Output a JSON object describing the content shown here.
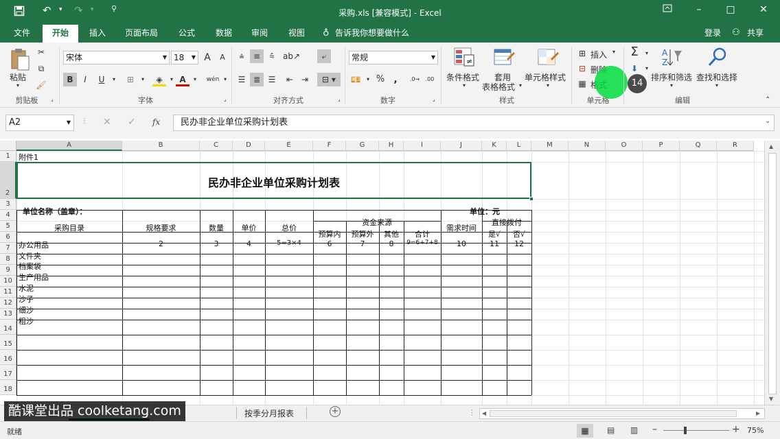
{
  "window": {
    "title": "采购.xls  [兼容模式] - Excel",
    "login": "登录",
    "share": "共享"
  },
  "tabs": [
    {
      "label": "文件"
    },
    {
      "label": "开始"
    },
    {
      "label": "插入"
    },
    {
      "label": "页面布局"
    },
    {
      "label": "公式"
    },
    {
      "label": "数据"
    },
    {
      "label": "审阅"
    },
    {
      "label": "视图"
    },
    {
      "label": "告诉我你想要做什么"
    }
  ],
  "ribbon": {
    "clipboard": {
      "paste": "粘贴",
      "group": "剪贴板"
    },
    "font": {
      "name": "宋体",
      "size": "18",
      "grow": "A",
      "shrink": "A",
      "bold": "B",
      "italic": "I",
      "underline": "U",
      "fontcolor": "A",
      "phonetic": "wén",
      "group": "字体"
    },
    "alignment": {
      "group": "对齐方式"
    },
    "number": {
      "format": "常规",
      "percent": "%",
      "comma": ",",
      "group": "数字"
    },
    "styles": {
      "conditional": "条件格式",
      "table1": "套用",
      "table2": "表格格式",
      "cell": "单元格样式",
      "group": "样式"
    },
    "cells": {
      "insert": "插入",
      "delete": "删除",
      "format": "格式",
      "group": "单元格"
    },
    "editing": {
      "sum": "Σ",
      "sort": "排序和筛选",
      "find": "查找和选择",
      "group": "编辑"
    },
    "step_badge": "14"
  },
  "formula": {
    "namebox": "A2",
    "fx": "fx",
    "content": "民办非企业单位采购计划表"
  },
  "grid": {
    "columns": [
      "A",
      "B",
      "C",
      "D",
      "E",
      "F",
      "G",
      "H",
      "I",
      "J",
      "K",
      "L",
      "M",
      "N",
      "O",
      "P",
      "Q",
      "R"
    ],
    "rows": [
      "1",
      "2",
      "3",
      "4",
      "5",
      "6",
      "7",
      "8",
      "9",
      "10",
      "11",
      "12",
      "13",
      "14",
      "15",
      "16",
      "17",
      "18"
    ],
    "cells": {
      "a1": "附件1",
      "title": "民办非企业单位采购计划表",
      "unit_name": "单位名称（盖章）：",
      "unit": "单位：元",
      "h_item": "采购目录",
      "h_spec": "规格要求",
      "h_qty": "数量",
      "h_price": "单价",
      "h_total": "总价",
      "h_fund": "资金来源",
      "h_inbudget": "预算内",
      "h_outbudget": "预算外",
      "h_other": "其他",
      "h_sum": "合计",
      "h_time": "需求时间",
      "h_direct": "直接拨付",
      "h_yes": "是√",
      "h_no": "否√",
      "r6": [
        "办公用品",
        "2",
        "3",
        "4",
        "5=3×4",
        "6",
        "7",
        "8",
        "9=6+7+8",
        "10",
        "11",
        "12"
      ],
      "r7": "文件夹",
      "r8": "档案袋",
      "r9": "生产用品",
      "r10": "水泥",
      "r11": "沙子",
      "r12": "细沙",
      "r13": "粗沙"
    }
  },
  "sheettabs": {
    "watermark": "酷课堂出品 coolketang.com",
    "tab2": "按季分月报表"
  },
  "status": {
    "ready": "就绪",
    "zoom": "75%"
  }
}
